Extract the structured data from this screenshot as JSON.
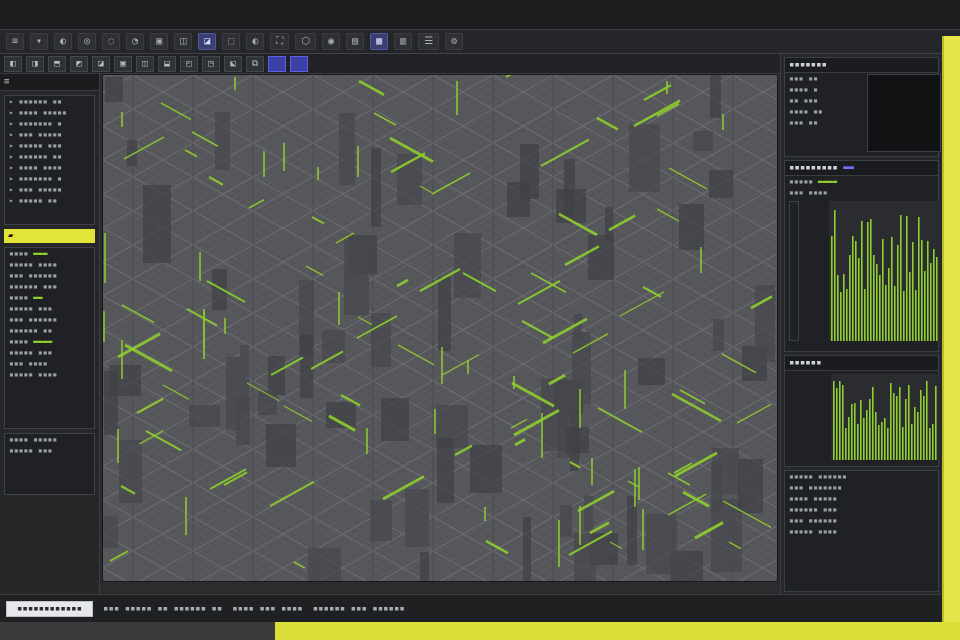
{
  "colors": {
    "accent_green": "#8fce2c",
    "accent_yellow": "#e6e64a",
    "accent_blue": "#3b3fa6",
    "viewport_bg": "#55565a"
  },
  "menu": {
    "items": [
      "≡",
      "▾",
      "◐",
      "◎",
      "◌",
      "◔",
      "▣",
      "◫",
      "◪",
      "⬚",
      "◐",
      "⛶",
      "⬡",
      "◉",
      "▤",
      "▦",
      "▥",
      "☰",
      "⚙"
    ]
  },
  "tools": {
    "icons": [
      {
        "glyph": "◧",
        "name": "layer-icon"
      },
      {
        "glyph": "◨",
        "name": "panel-icon"
      },
      {
        "glyph": "⬒",
        "name": "split-icon"
      },
      {
        "glyph": "◩",
        "name": "grid-icon"
      },
      {
        "glyph": "◪",
        "name": "frame-icon"
      },
      {
        "glyph": "▣",
        "name": "select-icon"
      },
      {
        "glyph": "◫",
        "name": "view-icon"
      },
      {
        "glyph": "⬓",
        "name": "stack-icon"
      },
      {
        "glyph": "◰",
        "name": "box-icon"
      },
      {
        "glyph": "◳",
        "name": "snap-icon"
      },
      {
        "glyph": "⬕",
        "name": "shape-icon"
      },
      {
        "glyph": "⧉",
        "name": "duplicate-icon"
      }
    ]
  },
  "left": {
    "header": "≡",
    "yellow_tab": "▰"
  },
  "right": {},
  "status": {},
  "bottom": {}
}
